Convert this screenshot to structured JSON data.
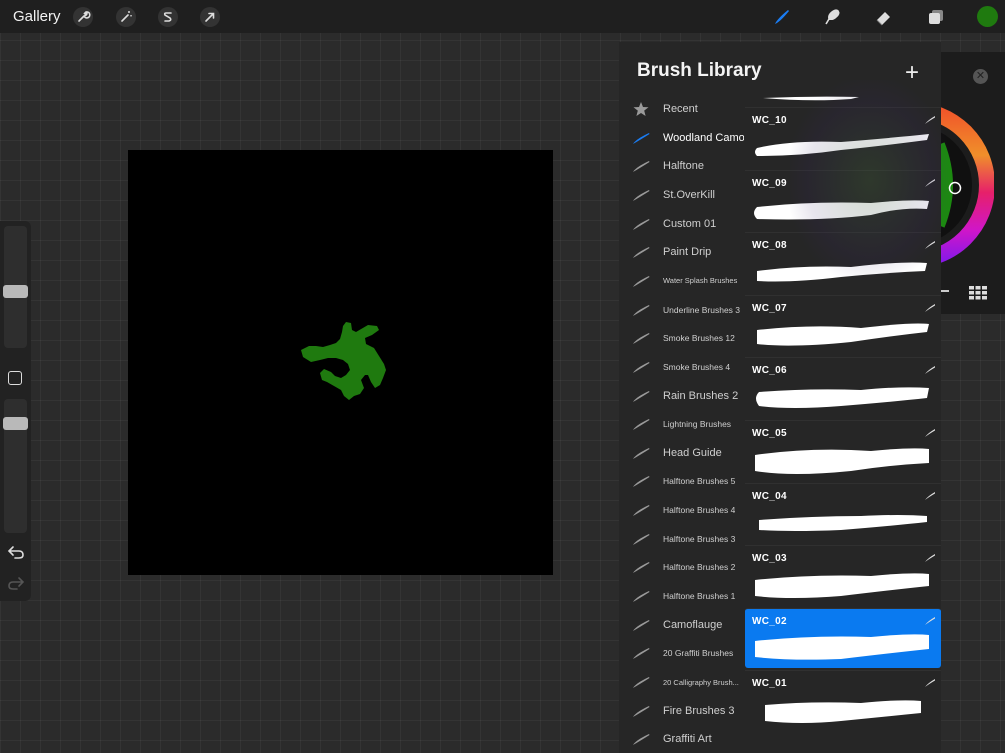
{
  "toolbar": {
    "gallery_label": "Gallery",
    "tools_left": [
      "wrench-icon",
      "magic-wand-icon",
      "selection-s-icon",
      "arrow-transform-icon"
    ],
    "tools_right": [
      "brush-icon",
      "smudge-icon",
      "eraser-icon",
      "layers-icon"
    ],
    "active_tool": "brush-icon",
    "current_color": "#1f7a0f",
    "accent_color": "#1a7cf2"
  },
  "sidebar": {
    "size_slider": 0.3,
    "opacity_slider": 0.85
  },
  "canvas": {
    "background": "#000000",
    "drawing_color": "#1f7a0f"
  },
  "library": {
    "title": "Brush Library",
    "add_label": "+",
    "brush_sets": [
      {
        "label": "Recent",
        "icon": "star-icon",
        "size": "n"
      },
      {
        "label": "Woodland Camo",
        "icon": "brush-set-icon",
        "size": "n",
        "active": true
      },
      {
        "label": "Halftone",
        "icon": "brush-set-icon",
        "size": "n"
      },
      {
        "label": "St.OverKill",
        "icon": "brush-set-icon",
        "size": "n"
      },
      {
        "label": "Custom 01",
        "icon": "brush-set-icon",
        "size": "n"
      },
      {
        "label": "Paint Drip",
        "icon": "brush-set-icon",
        "size": "n"
      },
      {
        "label": "Water Splash Brushes",
        "icon": "brush-set-icon",
        "size": "xs"
      },
      {
        "label": "Underline Brushes 3",
        "icon": "brush-set-icon",
        "size": "sm"
      },
      {
        "label": "Smoke Brushes 12",
        "icon": "brush-set-icon",
        "size": "sm"
      },
      {
        "label": "Smoke Brushes 4",
        "icon": "brush-set-icon",
        "size": "sm"
      },
      {
        "label": "Rain Brushes 2",
        "icon": "brush-set-icon",
        "size": "n"
      },
      {
        "label": "Lightning Brushes",
        "icon": "brush-set-icon",
        "size": "sm"
      },
      {
        "label": "Head Guide",
        "icon": "brush-set-icon",
        "size": "n"
      },
      {
        "label": "Halftone Brushes 5",
        "icon": "brush-set-icon",
        "size": "sm"
      },
      {
        "label": "Halftone Brushes 4",
        "icon": "brush-set-icon",
        "size": "sm"
      },
      {
        "label": "Halftone Brushes 3",
        "icon": "brush-set-icon",
        "size": "sm"
      },
      {
        "label": "Halftone Brushes 2",
        "icon": "brush-set-icon",
        "size": "sm"
      },
      {
        "label": "Halftone Brushes 1",
        "icon": "brush-set-icon",
        "size": "sm"
      },
      {
        "label": "Camoflauge",
        "icon": "brush-set-icon",
        "size": "n"
      },
      {
        "label": "20 Graffiti Brushes",
        "icon": "brush-set-icon",
        "size": "sm"
      },
      {
        "label": "20 Calligraphy Brush...",
        "icon": "brush-set-icon",
        "size": "xs"
      },
      {
        "label": "Fire Brushes 3",
        "icon": "brush-set-icon",
        "size": "n"
      },
      {
        "label": "Graffiti Art",
        "icon": "brush-set-icon",
        "size": "n"
      }
    ],
    "brushes": [
      {
        "name": "WC_10",
        "selected": false
      },
      {
        "name": "WC_09",
        "selected": false
      },
      {
        "name": "WC_08",
        "selected": false
      },
      {
        "name": "WC_07",
        "selected": false
      },
      {
        "name": "WC_06",
        "selected": false
      },
      {
        "name": "WC_05",
        "selected": false
      },
      {
        "name": "WC_04",
        "selected": false
      },
      {
        "name": "WC_03",
        "selected": false
      },
      {
        "name": "WC_02",
        "selected": true
      },
      {
        "name": "WC_01",
        "selected": false
      }
    ]
  }
}
